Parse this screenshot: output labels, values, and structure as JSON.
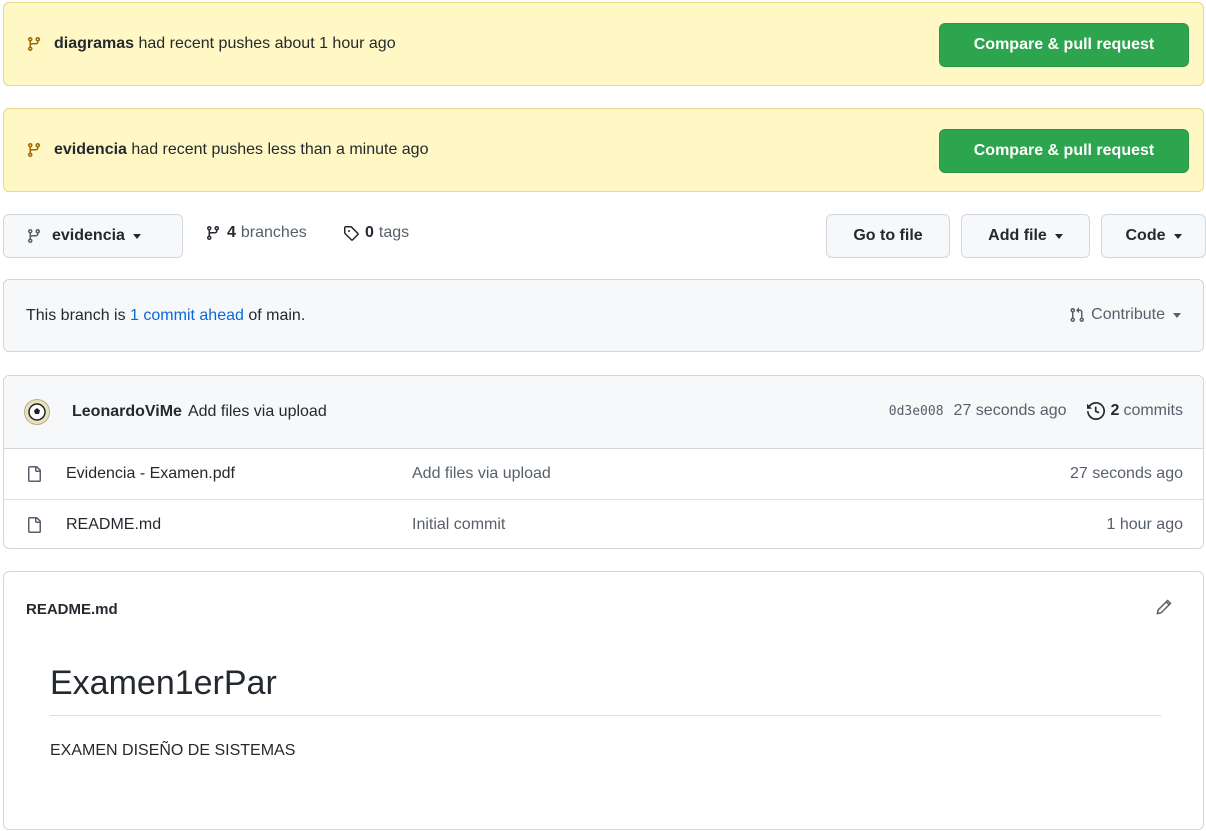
{
  "banners": [
    {
      "branch": "diagramas",
      "text": "had recent pushes about 1 hour ago",
      "button": "Compare & pull request"
    },
    {
      "branch": "evidencia",
      "text": "had recent pushes less than a minute ago",
      "button": "Compare & pull request"
    }
  ],
  "toolbar": {
    "branch_select": "evidencia",
    "branches_count": "4",
    "branches_label": "branches",
    "tags_count": "0",
    "tags_label": "tags",
    "go_to_file": "Go to file",
    "add_file": "Add file",
    "code": "Code"
  },
  "ahead": {
    "prefix": "This branch is",
    "link": "1 commit ahead",
    "suffix": "of main.",
    "contribute": "Contribute"
  },
  "latest_commit": {
    "author": "LeonardoViMe",
    "message": "Add files via upload",
    "sha": "0d3e008",
    "age": "27 seconds ago",
    "commits_count": "2",
    "commits_label": "commits"
  },
  "files": [
    {
      "name": "Evidencia - Examen.pdf",
      "message": "Add files via upload",
      "age": "27 seconds ago"
    },
    {
      "name": "README.md",
      "message": "Initial commit",
      "age": "1 hour ago"
    }
  ],
  "readme": {
    "filename": "README.md",
    "title": "Examen1erPar",
    "body": "EXAMEN DISEÑO DE SISTEMAS"
  },
  "colors": {
    "banner_bg": "#fff8c5",
    "green": "#2da44e",
    "link": "#0969da"
  }
}
